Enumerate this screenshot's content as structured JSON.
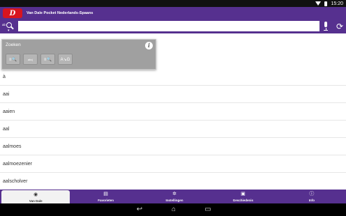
{
  "status_bar": {
    "time": "15:20"
  },
  "app_bar": {
    "title": "Van Dale Pocket Nederlands-Spaans",
    "logo_icon": "van-dale-logo",
    "logo_text": "D"
  },
  "search": {
    "mode_label": "ab",
    "value": "",
    "placeholder": ""
  },
  "popup": {
    "title": "Zoeken",
    "modes": [
      {
        "name": "search-mode-zoom",
        "glyph": "≡🔍"
      },
      {
        "name": "search-mode-fulltext",
        "glyph": "abc|"
      },
      {
        "name": "search-mode-advanced",
        "glyph": "≡🔍"
      },
      {
        "name": "search-mode-phonetic",
        "glyph": "A↘G"
      }
    ]
  },
  "words": [
    "à",
    "aai",
    "aaien",
    "aal",
    "aalmoes",
    "aalmoezenier",
    "aalscholver"
  ],
  "bottom_nav": [
    {
      "label": "Van Dale",
      "icon": "van-dale-icon"
    },
    {
      "label": "Favorieten",
      "icon": "favorites-icon"
    },
    {
      "label": "Instellingen",
      "icon": "settings-icon"
    },
    {
      "label": "Geschiedenis",
      "icon": "history-icon"
    },
    {
      "label": "Info",
      "icon": "info-icon"
    }
  ],
  "colors": {
    "brand_purple": "#56308f",
    "brand_red": "#d8141f"
  }
}
